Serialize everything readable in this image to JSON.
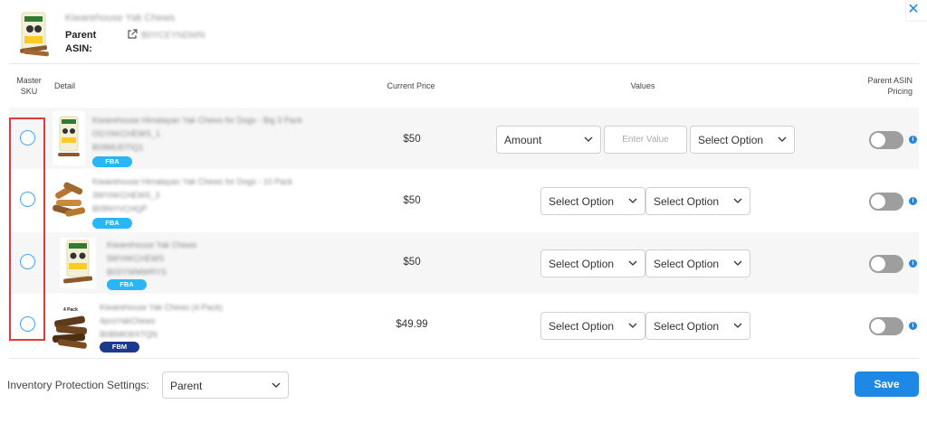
{
  "header": {
    "title": "Kiwarehouse Yak Chews",
    "parent_label": "Parent ASIN:",
    "parent_asin": "B0YCEYNDWN"
  },
  "table": {
    "columns": {
      "master_sku": "Master SKU",
      "detail": "Detail",
      "current_price": "Current Price",
      "values": "Values",
      "parent_asin_pricing": "Parent ASIN Pricing"
    },
    "rows": [
      {
        "title": "Kiwarehouse Himalayan Yak Chews for Dogs - Big 3 Pack",
        "sku": "OGYAKCHEWS_1",
        "asin": "B09MUDTIQ1",
        "badge": "FBA",
        "price": "$50",
        "select1": "Amount",
        "input_placeholder": "Enter Value",
        "select2": "Select Option",
        "pricing_on": false
      },
      {
        "title": "Kiwarehouse Himalayan Yak Chews for Dogs - 10 Pack",
        "sku": "3WYAKCHEWS_3",
        "asin": "B09NYVCHQP",
        "badge": "FBA",
        "price": "$50",
        "select1": "Select Option",
        "select2": "Select Option",
        "pricing_on": false
      },
      {
        "title": "Kiwarehouse Yak Chews",
        "sku": "5MYAKCHEWS",
        "asin": "B0SYWMWRYS",
        "badge": "FBA",
        "price": "$50",
        "select1": "Select Option",
        "select2": "Select Option",
        "pricing_on": false
      },
      {
        "title": "Kiwarehouse Yak Chews (4-Pack)",
        "sku": "4pcsYakChews",
        "asin": "B0BMKWXTQN",
        "badge": "FBM",
        "price": "$49.99",
        "select1": "Select Option",
        "select2": "Select Option",
        "pricing_on": false
      }
    ]
  },
  "footer": {
    "inventory_label": "Inventory Protection Settings:",
    "inventory_value": "Parent",
    "save_label": "Save"
  },
  "thumb_small_label": "4 Pack",
  "colors": {
    "accent": "#1e88e5",
    "fba_badge": "#29b6f6",
    "fbm_badge": "#1a3a8f",
    "highlight": "#e53935",
    "toggle_off": "#9e9e9e"
  }
}
